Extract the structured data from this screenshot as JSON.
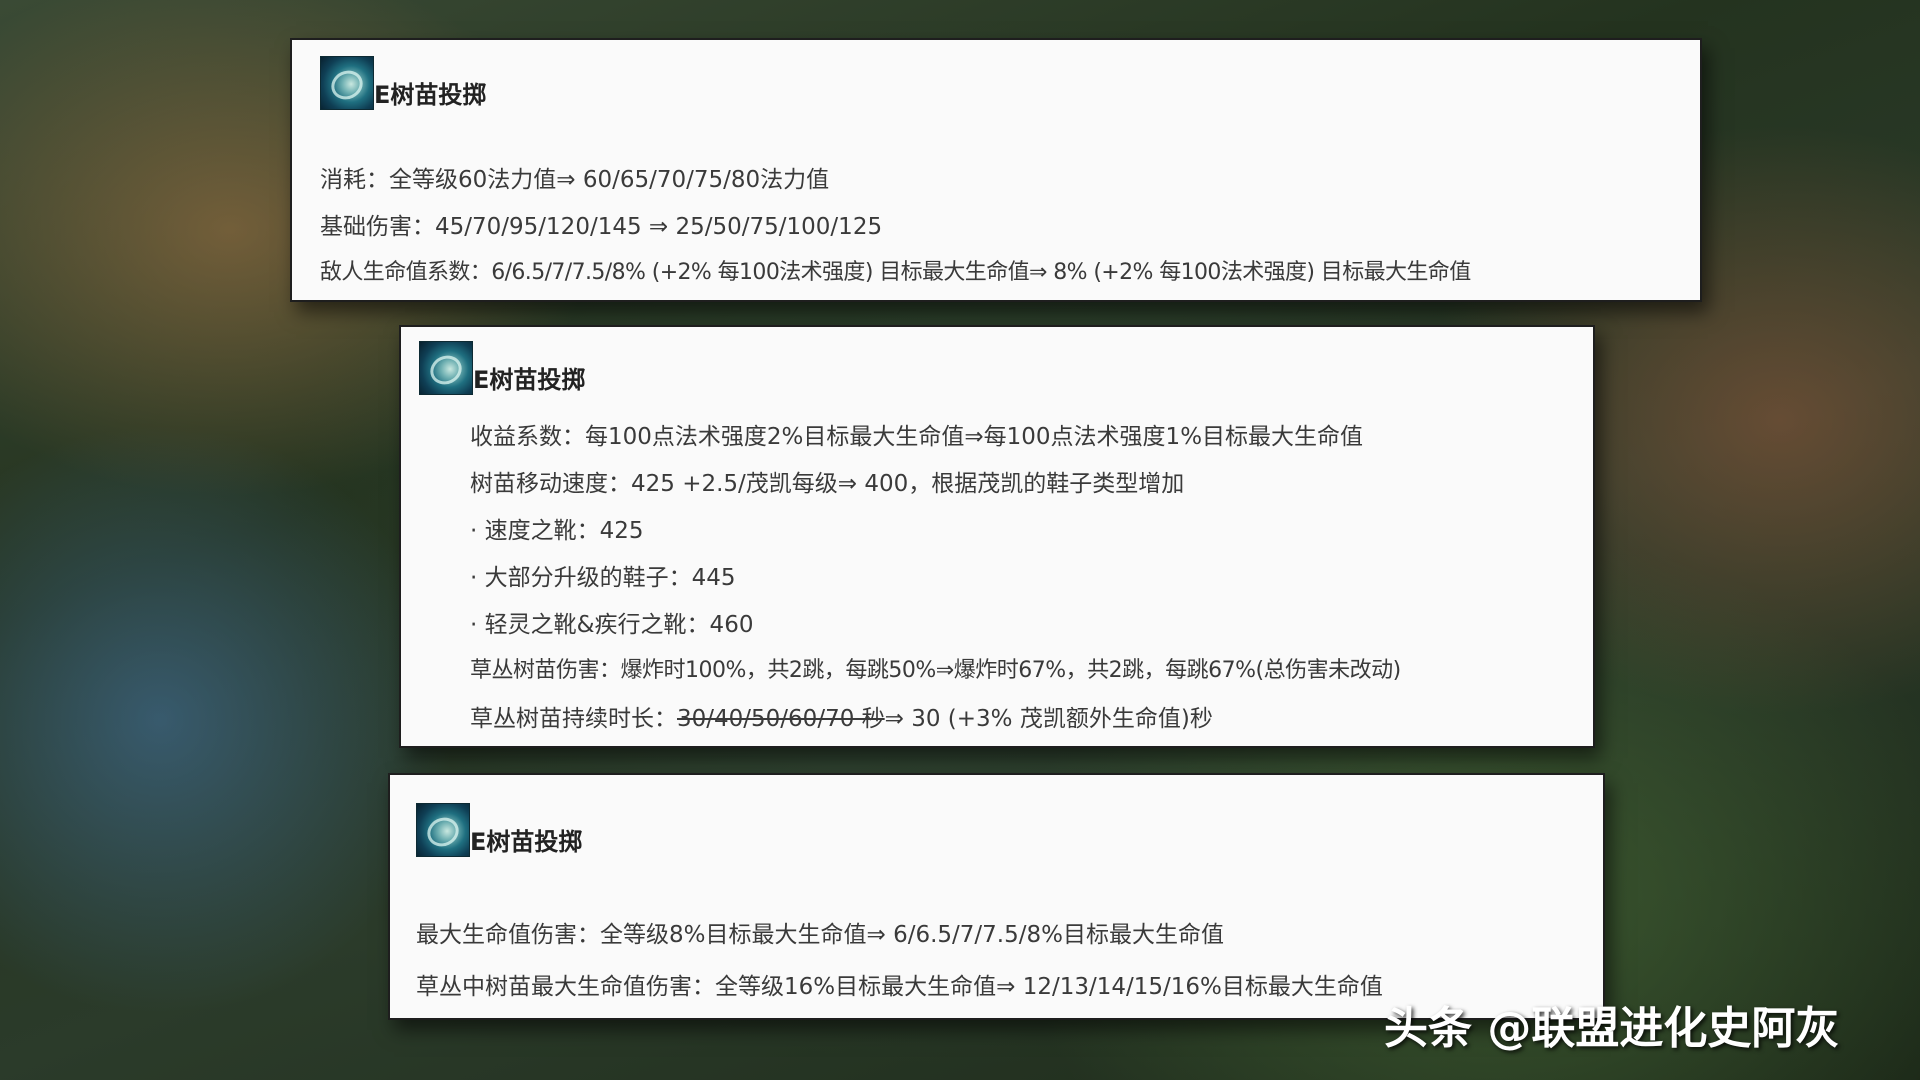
{
  "cards": [
    {
      "title": "E树苗投掷",
      "lines": [
        "消耗：全等级60法力值⇒ 60/65/70/75/80法力值",
        "基础伤害：45/70/95/120/145 ⇒ 25/50/75/100/125",
        "敌人生命值系数：6/6.5/7/7.5/8% (+2% 每100法术强度) 目标最大生命值⇒ 8% (+2% 每100法术强度) 目标最大生命值"
      ]
    },
    {
      "title": "E树苗投掷",
      "lines": [
        "收益系数：每100点法术强度2%目标最大生命值⇒每100点法术强度1%目标最大生命值",
        "树苗移动速度：425 +2.5/茂凯每级⇒ 400，根据茂凯的鞋子类型增加",
        "· 速度之靴：425",
        "· 大部分升级的鞋子：445",
        "· 轻灵之靴&疾行之靴：460",
        "草丛树苗伤害：爆炸时100%，共2跳，每跳50%⇒爆炸时67%，共2跳，每跳67%(总伤害未改动)"
      ],
      "duration_line": {
        "label": "草丛树苗持续时长：",
        "old": "30/40/50/60/70 秒",
        "new": "⇒ 30 (+3% 茂凯额外生命值)秒"
      }
    },
    {
      "title": "E树苗投掷",
      "lines": [
        "最大生命值伤害：全等级8%目标最大生命值⇒ 6/6.5/7/7.5/8%目标最大生命值",
        "草丛中树苗最大生命值伤害：全等级16%目标最大生命值⇒ 12/13/14/15/16%目标最大生命值"
      ]
    }
  ],
  "watermark": "头条 @联盟进化史阿灰"
}
